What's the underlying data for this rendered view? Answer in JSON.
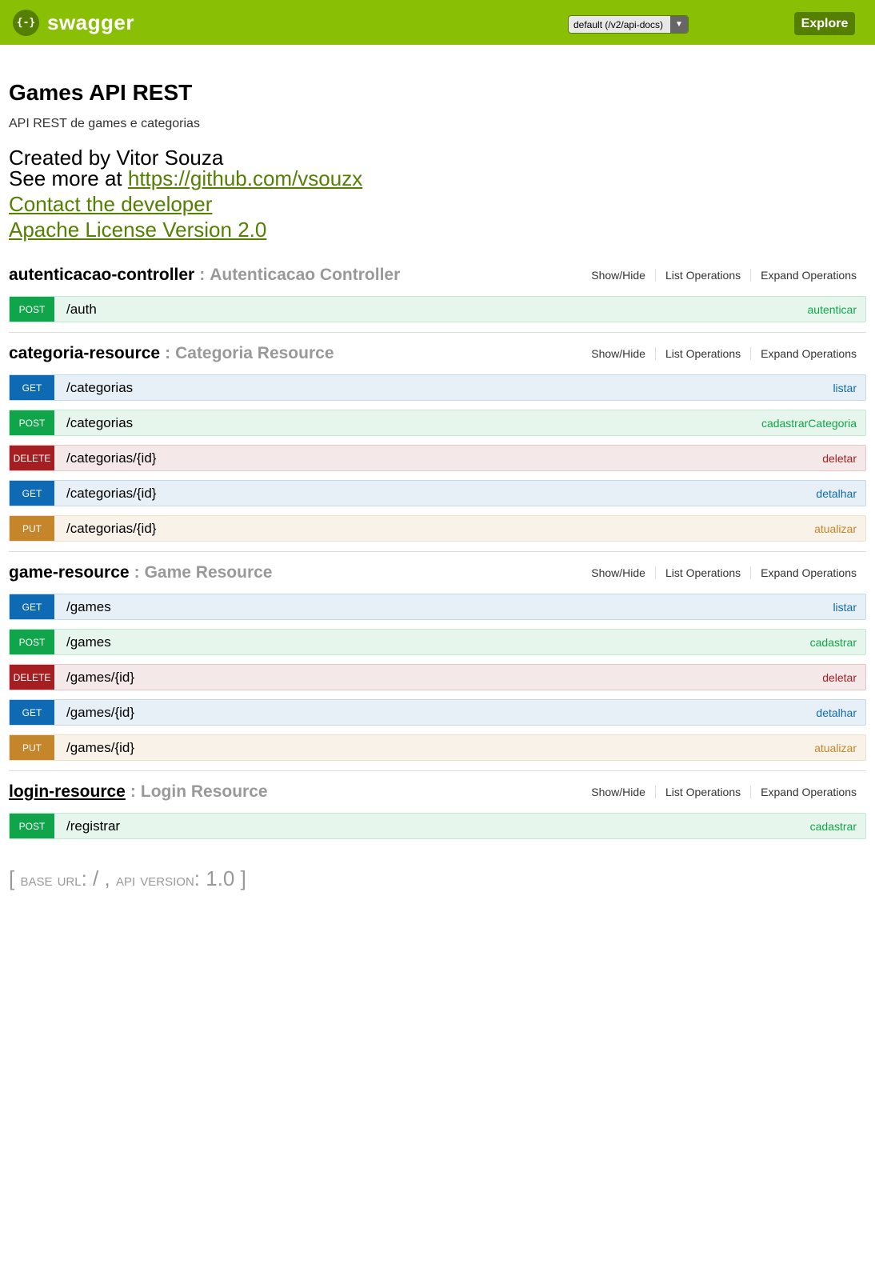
{
  "header": {
    "logo_icon": "{-}",
    "logo_text": "swagger",
    "spec_select": "default (/v2/api-docs)",
    "spec_select_arrow": "▼",
    "explore_label": "Explore"
  },
  "info": {
    "title": "Games API REST",
    "description": "API REST de games e categorias",
    "created_by": "Created by Vitor Souza",
    "see_more_prefix": "See more at ",
    "see_more_link": "https://github.com/vsouzx",
    "contact_link": "Contact the developer",
    "license_link": "Apache License Version 2.0"
  },
  "actions": {
    "show_hide": "Show/Hide",
    "list_ops": "List Operations",
    "expand_ops": "Expand Operations"
  },
  "colors": {
    "header_bg": "#89bf04",
    "accent_dark": "#547f00",
    "get": "#0f6ab4",
    "post": "#10a54a",
    "delete": "#a41e22",
    "put": "#c5862b"
  },
  "resources": [
    {
      "name": "autenticacao-controller",
      "separator": ":",
      "description": "Autenticacao Controller",
      "operations": [
        {
          "method": "POST",
          "path": "/auth",
          "nickname": "autenticar"
        }
      ]
    },
    {
      "name": "categoria-resource",
      "separator": ":",
      "description": "Categoria Resource",
      "operations": [
        {
          "method": "GET",
          "path": "/categorias",
          "nickname": "listar"
        },
        {
          "method": "POST",
          "path": "/categorias",
          "nickname": "cadastrarCategoria"
        },
        {
          "method": "DELETE",
          "path": "/categorias/{id}",
          "nickname": "deletar"
        },
        {
          "method": "GET",
          "path": "/categorias/{id}",
          "nickname": "detalhar"
        },
        {
          "method": "PUT",
          "path": "/categorias/{id}",
          "nickname": "atualizar"
        }
      ]
    },
    {
      "name": "game-resource",
      "separator": ":",
      "description": "Game Resource",
      "operations": [
        {
          "method": "GET",
          "path": "/games",
          "nickname": "listar"
        },
        {
          "method": "POST",
          "path": "/games",
          "nickname": "cadastrar"
        },
        {
          "method": "DELETE",
          "path": "/games/{id}",
          "nickname": "deletar"
        },
        {
          "method": "GET",
          "path": "/games/{id}",
          "nickname": "detalhar"
        },
        {
          "method": "PUT",
          "path": "/games/{id}",
          "nickname": "atualizar"
        }
      ]
    },
    {
      "name": "login-resource",
      "separator": ":",
      "description": "Login Resource",
      "operations": [
        {
          "method": "POST",
          "path": "/registrar",
          "nickname": "cadastrar"
        }
      ]
    }
  ],
  "footer": {
    "open_bracket": "[",
    "base_url_label": "base url",
    "base_url_value": ": / ,",
    "api_version_label": "api version",
    "api_version_value": ": 1.0",
    "close_bracket": "]"
  }
}
